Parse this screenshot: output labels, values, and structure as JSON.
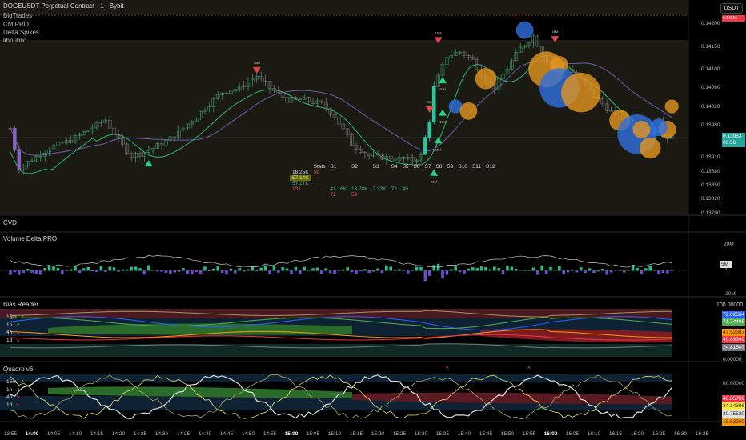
{
  "header": {
    "symbol": "DOGEUSDT Perpetual Contract · 1 · Bybit",
    "indicators": [
      "BigTrades",
      "CM PRO",
      "Delta Spikes",
      "libpublic"
    ]
  },
  "currency_button": "USDT",
  "price_axis": {
    "labels": [
      "0.14200",
      "0.14150",
      "0.14100",
      "0.14060",
      "0.14020",
      "0.13980",
      "0.13910",
      "0.13880",
      "0.13850",
      "0.13820",
      "0.13790"
    ],
    "current_price": "0.13953",
    "countdown": "00:56",
    "high_tag": "0.14216"
  },
  "price_path": [
    [
      0,
      0.13973
    ],
    [
      2,
      0.13887
    ],
    [
      9,
      0.1393
    ],
    [
      14,
      0.13947
    ],
    [
      22,
      0.13991
    ],
    [
      25,
      0.13947
    ],
    [
      28,
      0.13913
    ],
    [
      31,
      0.13921
    ],
    [
      35,
      0.13939
    ],
    [
      38,
      0.13956
    ],
    [
      42,
      0.13991
    ],
    [
      46,
      0.14025
    ],
    [
      49,
      0.14051
    ],
    [
      53,
      0.1406
    ],
    [
      57,
      0.14086
    ],
    [
      60,
      0.1406
    ],
    [
      64,
      0.14034
    ],
    [
      68,
      0.14034
    ],
    [
      72,
      0.14025
    ],
    [
      75,
      0.13999
    ],
    [
      79,
      0.13939
    ],
    [
      83,
      0.13913
    ],
    [
      88,
      0.13909
    ],
    [
      93,
      0.13904
    ],
    [
      95,
      0.13913
    ],
    [
      97,
      0.13991
    ],
    [
      98,
      0.1406
    ],
    [
      101,
      0.14129
    ],
    [
      104,
      0.14138
    ],
    [
      107,
      0.1412
    ],
    [
      110,
      0.14077
    ],
    [
      112,
      0.1406
    ],
    [
      115,
      0.14103
    ],
    [
      118,
      0.14146
    ],
    [
      121,
      0.14172
    ],
    [
      124,
      0.1412
    ],
    [
      126,
      0.14094
    ],
    [
      129,
      0.14103
    ],
    [
      132,
      0.14077
    ],
    [
      135,
      0.14043
    ],
    [
      139,
      0.14008
    ],
    [
      142,
      0.13991
    ],
    [
      146,
      0.13973
    ],
    [
      148,
      0.13965
    ],
    [
      150,
      0.13991
    ],
    [
      151,
      0.13956
    ],
    [
      153,
      0.13953
    ]
  ],
  "bubbles": [
    [
      119,
      0.14185,
      "buy",
      3
    ],
    [
      124,
      0.141,
      "sell",
      8
    ],
    [
      127,
      0.1411,
      "sell",
      3
    ],
    [
      110,
      0.1408,
      "sell",
      4
    ],
    [
      103,
      0.1402,
      "buy",
      2
    ],
    [
      106,
      0.1401,
      "sell",
      3
    ],
    [
      127,
      0.1406,
      "buy",
      9
    ],
    [
      132,
      0.1405,
      "sell",
      9
    ],
    [
      141,
      0.1399,
      "sell",
      4
    ],
    [
      145,
      0.1396,
      "buy",
      9
    ],
    [
      146,
      0.1397,
      "sell",
      3
    ],
    [
      148,
      0.1393,
      "sell",
      4
    ],
    [
      152,
      0.1397,
      "sell",
      3
    ],
    [
      150,
      0.13975,
      "buy",
      3
    ],
    [
      153,
      0.1402,
      "sell",
      2
    ]
  ],
  "markers": [
    [
      57,
      0.14105,
      "down",
      "10M"
    ],
    [
      99,
      0.1417,
      "down",
      "10M"
    ],
    [
      97,
      0.1402,
      "down",
      "7M"
    ],
    [
      98,
      0.1387,
      "up",
      "20M"
    ],
    [
      100,
      0.14,
      "up",
      "11M"
    ],
    [
      99,
      0.1394,
      "up",
      "15M"
    ],
    [
      126,
      0.14172,
      "down",
      "11M"
    ],
    [
      100,
      0.1407,
      "up",
      "20M"
    ],
    [
      32,
      0.1389,
      "up",
      ""
    ]
  ],
  "stats": {
    "headers": [
      "Stats",
      "S1",
      "S2",
      "S3",
      "S4",
      "S5",
      "S6",
      "S7",
      "S8",
      "S9",
      "S10",
      "S11",
      "S12"
    ],
    "col1": [
      "18.25K",
      "57.14K",
      "57.27K",
      "131"
    ],
    "row1_red": "59",
    "row4": [
      "41.16K",
      "13.78K",
      "2.33K",
      "72",
      "40"
    ],
    "row5": [
      "72",
      "59"
    ]
  },
  "panels": {
    "cvd": {
      "title": "CVD"
    },
    "volume_delta": {
      "title": "Volume Delta PRO",
      "axis": [
        "20M",
        "0",
        "-20M"
      ],
      "tag": "5M"
    },
    "bias": {
      "title": "Bias Reader",
      "axis": [
        "100.00000",
        "0.00000"
      ],
      "tags": [
        [
          "72.02564",
          "#2962ff"
        ],
        [
          "71.74409",
          "#4caf50"
        ],
        [
          "47.52387",
          "#ff9800"
        ],
        [
          "40.89349",
          "#f23645"
        ],
        [
          "24.81507",
          "#787b86"
        ]
      ],
      "tfs": [
        [
          "15m",
          "↗",
          "#4caf50"
        ],
        [
          "1h",
          "↗",
          "#4caf50"
        ],
        [
          "4h",
          "↘",
          "#f23645"
        ],
        [
          "1d",
          "↘",
          "#f23645"
        ]
      ]
    },
    "quadro": {
      "title": "Quadro v6",
      "axis": [
        "80.00000"
      ],
      "tags": [
        [
          "40.85782",
          "#f23645"
        ],
        [
          "34.14396",
          "#ffeb3b"
        ],
        [
          "30.75520",
          "#e0e0e0"
        ],
        [
          "18.63260",
          "#ff9800"
        ]
      ],
      "tfs": [
        [
          "15m",
          "↗",
          "#4caf50"
        ],
        [
          "1h",
          "↗",
          "#4caf50"
        ],
        [
          "4h",
          "↘",
          "#f23645"
        ],
        [
          "1d",
          "↘",
          "#f23645"
        ]
      ]
    }
  },
  "time_axis": [
    "13:55",
    "14:00",
    "14:05",
    "14:10",
    "14:15",
    "14:20",
    "14:25",
    "14:30",
    "14:35",
    "14:40",
    "14:45",
    "14:50",
    "14:55",
    "15:00",
    "15:05",
    "15:10",
    "15:15",
    "15:20",
    "15:25",
    "15:30",
    "15:35",
    "15:40",
    "15:45",
    "15:50",
    "15:55",
    "16:00",
    "16:05",
    "16:10",
    "16:15",
    "16:20",
    "16:25",
    "16:30",
    "16:35"
  ],
  "colors": {
    "up": "#26c6a0",
    "down": "#8a8a8a",
    "buy_bubble": "#2f6fe0",
    "sell_bubble": "#e3951f",
    "ma_fast": "#2bb673",
    "ma_slow": "#6a5fb0"
  }
}
